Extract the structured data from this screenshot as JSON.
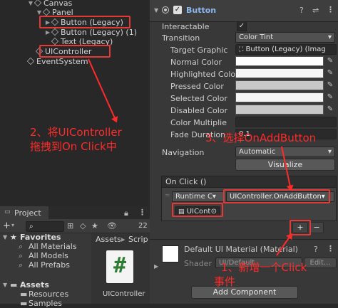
{
  "hierarchy": {
    "items": [
      {
        "label": "Canvas"
      },
      {
        "label": "Panel"
      },
      {
        "label": "Button (Legacy)"
      },
      {
        "label": "Button (Legacy) (1)"
      },
      {
        "label": "Text (Legacy)"
      },
      {
        "label": "UIController"
      },
      {
        "label": "EventSystem"
      }
    ]
  },
  "inspector": {
    "component_title": "Button",
    "interactable_label": "Interactable",
    "transition_label": "Transition",
    "transition_value": "Color Tint",
    "target_graphic_label": "Target Graphic",
    "target_graphic_value": "Button (Legacy) (Imag",
    "normal_color_label": "Normal Color",
    "highlighted_color_label": "Highlighted Color",
    "pressed_color_label": "Pressed Color",
    "selected_color_label": "Selected Color",
    "disabled_color_label": "Disabled Color",
    "color_multiplier_label": "Color Multiplie",
    "fade_duration_label": "Fade Duration",
    "fade_duration_value": "0.1",
    "navigation_label": "Navigation",
    "navigation_value": "Automatic",
    "visualize_label": "Visualize",
    "onclick_label": "On Click ()",
    "runtime_label": "Runtime C▾",
    "function_value": "UIController.OnAddButton▾",
    "object_value": "UICont",
    "plus_label": "+",
    "minus_label": "−",
    "material_label": "Default UI Material (Material)",
    "shader_label": "Shader",
    "shader_value": "UI/Default",
    "edit_label": "Edit...",
    "add_component_label": "Add Component"
  },
  "project": {
    "tab_label": "Project",
    "count": "22",
    "favorites_label": "Favorites",
    "fav_items": [
      "All Materials",
      "All Models",
      "All Prefabs"
    ],
    "assets_label": "Assets",
    "asset_items": [
      "Resources",
      "Samples"
    ],
    "breadcrumb_assets": "Assets",
    "breadcrumb_sep": "▸",
    "breadcrumb_scripts": "Scrip",
    "file_name": "UIController",
    "file_glyph": "#"
  },
  "annotations": {
    "step1_line1": "1、新增一个Click",
    "step1_line2": "事件",
    "step2_line1": "2、将UIController",
    "step2_line2": "拖拽到On Click中",
    "step3": "3、选择OnAddButton"
  },
  "colors": {
    "normal": "#ffffff",
    "highlighted": "#f5f5f5",
    "pressed": "#c8c8c8",
    "selected": "#f5f5f5",
    "disabled": "#c8c8c8",
    "annotation": "#ff2a2a",
    "accent": "#4a90d9"
  }
}
